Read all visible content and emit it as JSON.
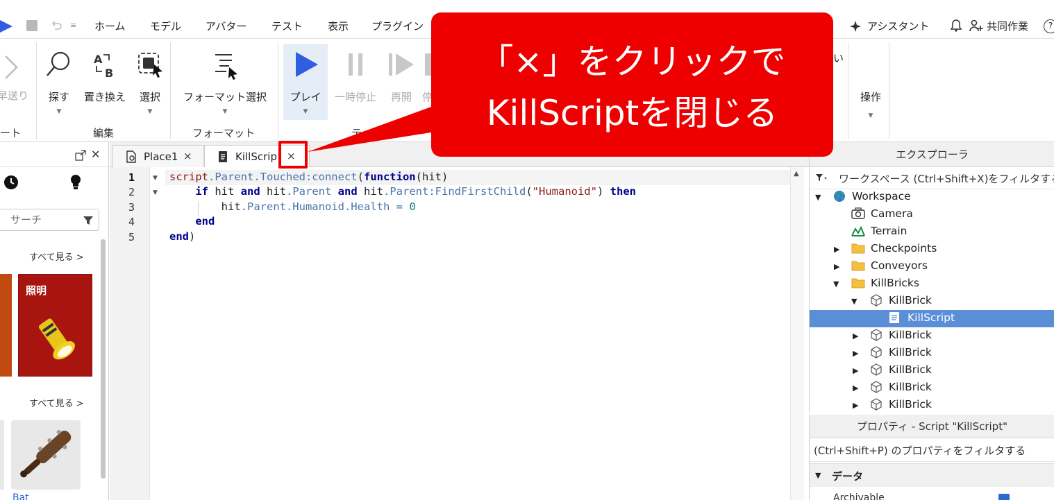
{
  "menubar": {
    "items": [
      "ホーム",
      "モデル",
      "アバター",
      "テスト",
      "表示",
      "プラグイン"
    ],
    "assistant": "アシスタント",
    "collab": "共同作業",
    "help": "?"
  },
  "ribbon": {
    "partial_left_label": "早送り",
    "partial_group_label": "ート",
    "edit_group": {
      "find": "探す",
      "replace": "置き換え",
      "select": "選択",
      "label": "編集"
    },
    "format_group": {
      "format_select": "フォーマット選択",
      "label": "フォーマット"
    },
    "test_group": {
      "play": "プレイ",
      "pause": "一時停止",
      "resume": "再開",
      "stop_partial": "停",
      "label_partial": "テ"
    },
    "partial_right": "い",
    "actions": "操作"
  },
  "toolbox": {
    "search_placeholder": "サーチ",
    "see_all_1": "すべて見る >",
    "see_all_2": "すべて見る >",
    "card_lighting": "照明",
    "card_bat_partial": "Bat"
  },
  "editor": {
    "tabs": [
      {
        "label": "Place1",
        "close": "×"
      },
      {
        "label": "KillScrip",
        "close": "×"
      }
    ],
    "line_numbers": [
      "1",
      "2",
      "3",
      "4",
      "5"
    ]
  },
  "explorer": {
    "title": "エクスプローラ",
    "filter": "ワークスペース (Ctrl+Shift+X)をフィルタする",
    "tree": [
      {
        "label": "Workspace",
        "icon": "globe-icon"
      },
      {
        "label": "Camera",
        "icon": "camera-icon"
      },
      {
        "label": "Terrain",
        "icon": "terrain-icon"
      },
      {
        "label": "Checkpoints",
        "icon": "folder-icon"
      },
      {
        "label": "Conveyors",
        "icon": "folder-icon"
      },
      {
        "label": "KillBricks",
        "icon": "folder-icon"
      },
      {
        "label": "KillBrick",
        "icon": "part-icon"
      },
      {
        "label": "KillScript",
        "icon": "script-icon"
      },
      {
        "label": "KillBrick",
        "icon": "part-icon"
      },
      {
        "label": "KillBrick",
        "icon": "part-icon"
      },
      {
        "label": "KillBrick",
        "icon": "part-icon"
      },
      {
        "label": "KillBrick",
        "icon": "part-icon"
      },
      {
        "label": "KillBrick",
        "icon": "part-icon"
      }
    ]
  },
  "properties": {
    "title": "プロパティ - Script \"KillScript\"",
    "filter": "(Ctrl+Shift+P) のプロパティをフィルタする",
    "section": "データ",
    "first_prop_partial": "Archivable"
  },
  "callout": {
    "line1": "「×」をクリックで",
    "line2": "KillScriptを閉じる"
  },
  "colors": {
    "accent_red": "#ee0000",
    "selection": "#5a8fd8",
    "play_blue": "#2f5ee0"
  }
}
